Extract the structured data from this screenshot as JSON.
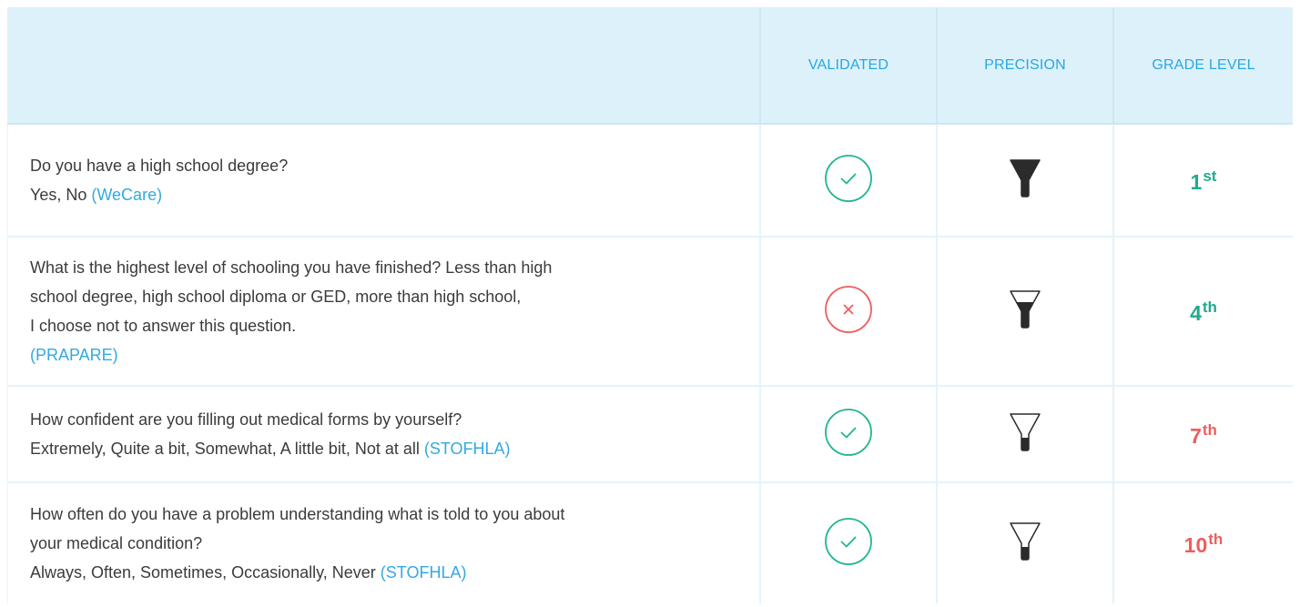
{
  "colors": {
    "header_bg": "#ddf1fa",
    "header_text": "#29a8e0",
    "source_link": "#33a9e0",
    "check_green": "#22b590",
    "cross_red": "#ef5d5d",
    "grade_green": "#22a98d",
    "grade_red": "#ef5d5d"
  },
  "header": {
    "corner": "",
    "validated": "VALIDATED",
    "precision": "PRECISION",
    "grade_level": "GRADE LEVEL"
  },
  "rows": [
    {
      "question_lines": [
        "Do you have a high school degree?",
        "Yes, No "
      ],
      "source": "(WeCare)",
      "validated": true,
      "validated_icon": "check-circle-icon",
      "precision_icon": "funnel-full-icon",
      "precision_fill": 1.0,
      "grade_number": "1",
      "grade_suffix": "st",
      "grade_color": "green"
    },
    {
      "question_lines": [
        "What is the highest level of schooling you have finished? Less than high",
        "school degree, high school diploma or GED, more than high school,",
        "I choose not to answer this question."
      ],
      "source": "(PRAPARE)",
      "validated": false,
      "validated_icon": "x-circle-icon",
      "precision_icon": "funnel-half-icon",
      "precision_fill": 0.5,
      "grade_number": "4",
      "grade_suffix": "th",
      "grade_color": "green"
    },
    {
      "question_lines": [
        "How confident are you filling out medical forms by yourself?",
        "Extremely, Quite a bit, Somewhat, A little bit, Not at all "
      ],
      "source": "(STOFHLA)",
      "validated": true,
      "validated_icon": "check-circle-icon",
      "precision_icon": "funnel-empty-icon",
      "precision_fill": 0.0,
      "grade_number": "7",
      "grade_suffix": "th",
      "grade_color": "red"
    },
    {
      "question_lines": [
        "How often do you have a problem understanding what is told to you about",
        "your medical condition?",
        "Always, Often, Sometimes, Occasionally, Never "
      ],
      "source": "(STOFHLA)",
      "validated": true,
      "validated_icon": "check-circle-icon",
      "precision_icon": "funnel-empty-icon",
      "precision_fill": 0.0,
      "grade_number": "10",
      "grade_suffix": "th",
      "grade_color": "red"
    }
  ]
}
